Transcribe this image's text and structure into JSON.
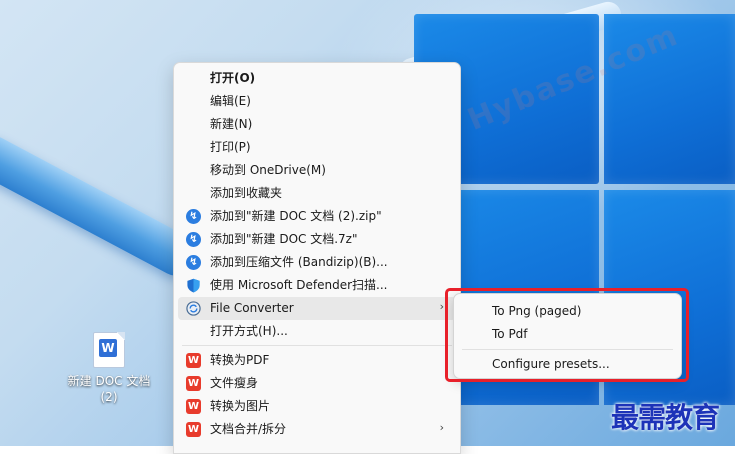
{
  "desktop": {
    "icon_label": "新建 DOC 文档 (2)",
    "watermark": "收藏·黑域基地  Hybase.com",
    "logo": "最需教育"
  },
  "context_menu": {
    "items": [
      {
        "label": "打开(O)",
        "icon": "none",
        "bold": true
      },
      {
        "label": "编辑(E)",
        "icon": "none"
      },
      {
        "label": "新建(N)",
        "icon": "none"
      },
      {
        "label": "打印(P)",
        "icon": "none"
      },
      {
        "label": "移动到 OneDrive(M)",
        "icon": "none"
      },
      {
        "label": "添加到收藏夹",
        "icon": "none"
      },
      {
        "label": "添加到\"新建 DOC 文档 (2).zip\"",
        "icon": "bandizip-icon"
      },
      {
        "label": "添加到\"新建 DOC 文档.7z\"",
        "icon": "bandizip-icon"
      },
      {
        "label": "添加到压缩文件 (Bandizip)(B)...",
        "icon": "bandizip-icon"
      },
      {
        "label": "使用 Microsoft Defender扫描...",
        "icon": "defender-shield-icon"
      },
      {
        "label": "File Converter",
        "icon": "file-converter-icon",
        "submenu": true
      },
      {
        "label": "打开方式(H)...",
        "icon": "none"
      },
      {
        "label": "转换为PDF",
        "icon": "wps-icon"
      },
      {
        "label": "文件瘦身",
        "icon": "wps-icon"
      },
      {
        "label": "转换为图片",
        "icon": "wps-icon"
      },
      {
        "label": "文档合并/拆分",
        "icon": "wps-icon",
        "submenu": true
      }
    ]
  },
  "file_converter_submenu": {
    "items": [
      {
        "label": "To Png (paged)"
      },
      {
        "label": "To Pdf"
      },
      {
        "label": "Configure presets..."
      }
    ]
  },
  "colors": {
    "highlight_box": "#e8202a",
    "wps_red": "#e83b2c",
    "bandizip_blue": "#2b7de0",
    "logo_blue": "#1d33b8"
  }
}
